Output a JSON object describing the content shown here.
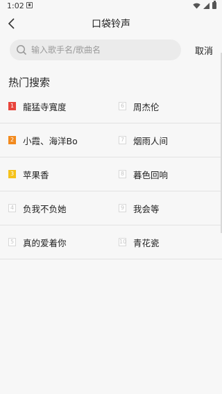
{
  "status": {
    "time": "1:02"
  },
  "header": {
    "title": "口袋铃声"
  },
  "search": {
    "placeholder": "输入歌手名/歌曲名",
    "cancel_label": "取消"
  },
  "hot": {
    "title": "热门搜索",
    "rows": [
      {
        "left": {
          "rank": "1",
          "text": "龍猛寺寬度",
          "badge_color": "#e8453c"
        },
        "right": {
          "rank": "6",
          "text": "周杰伦"
        }
      },
      {
        "left": {
          "rank": "2",
          "text": "小霞、海洋Bo",
          "badge_color": "#f28a1e"
        },
        "right": {
          "rank": "7",
          "text": "烟雨人间"
        }
      },
      {
        "left": {
          "rank": "3",
          "text": "苹果香",
          "badge_color": "#f5c21b"
        },
        "right": {
          "rank": "8",
          "text": "暮色回响"
        }
      },
      {
        "left": {
          "rank": "4",
          "text": "负我不负她"
        },
        "right": {
          "rank": "9",
          "text": "我会等"
        }
      },
      {
        "left": {
          "rank": "5",
          "text": "真的爱着你"
        },
        "right": {
          "rank": "10",
          "text": "青花瓷"
        }
      }
    ]
  }
}
